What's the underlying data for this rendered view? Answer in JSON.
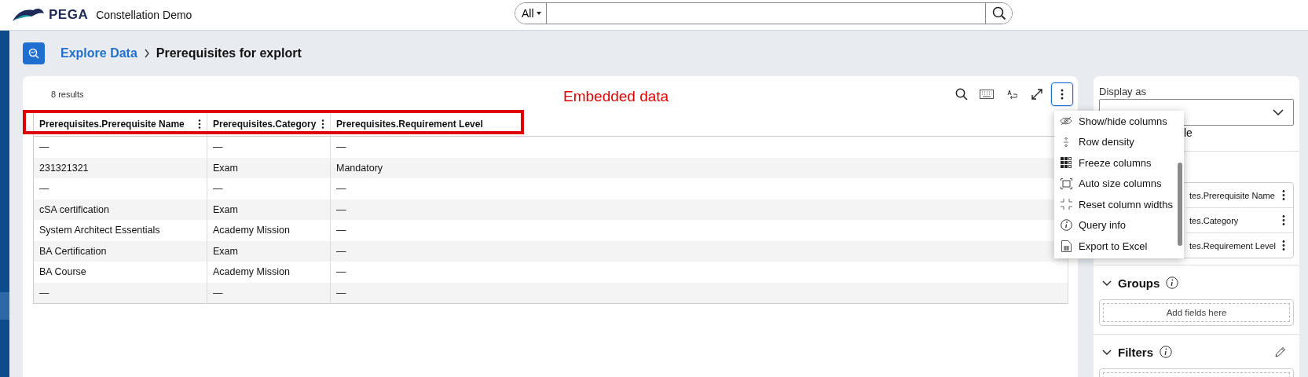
{
  "header": {
    "brand": "PEGA",
    "app_name": "Constellation Demo",
    "search": {
      "scope": "All"
    }
  },
  "breadcrumb": {
    "parent": "Explore Data",
    "current": "Prerequisites for explort"
  },
  "results_count": "8 results",
  "annotation": "Embedded data",
  "table": {
    "columns": [
      "Prerequisites.Prerequisite Name",
      "Prerequisites.Category",
      "Prerequisites.Requirement Level"
    ],
    "rows": [
      [
        "—",
        "—",
        "—"
      ],
      [
        "231321321",
        "Exam",
        "Mandatory"
      ],
      [
        "—",
        "—",
        "—"
      ],
      [
        "cSA certification",
        "Exam",
        "—"
      ],
      [
        "System Architect Essentials",
        "Academy Mission",
        "—"
      ],
      [
        "BA Certification",
        "Exam",
        "—"
      ],
      [
        "BA Course",
        "Academy Mission",
        "—"
      ],
      [
        "—",
        "—",
        "—"
      ]
    ]
  },
  "menu": {
    "items": [
      {
        "label": "Show/hide columns",
        "kind": "eye"
      },
      {
        "label": "Row density",
        "kind": "density"
      },
      {
        "label": "Freeze columns",
        "kind": "grid"
      },
      {
        "label": "Auto size columns",
        "kind": "autosize"
      },
      {
        "label": "Reset column widths",
        "kind": "reset"
      },
      {
        "label": "Query info",
        "kind": "info"
      },
      {
        "label": "Export to Excel",
        "kind": "excel"
      }
    ]
  },
  "side_panel": {
    "display_as_label": "Display as",
    "display_option": "le",
    "columns": [
      "tes.Prerequisite Name",
      "tes.Category",
      "tes.Requirement Level"
    ],
    "groups": {
      "title": "Groups",
      "placeholder": "Add fields here"
    },
    "filters": {
      "title": "Filters"
    }
  }
}
